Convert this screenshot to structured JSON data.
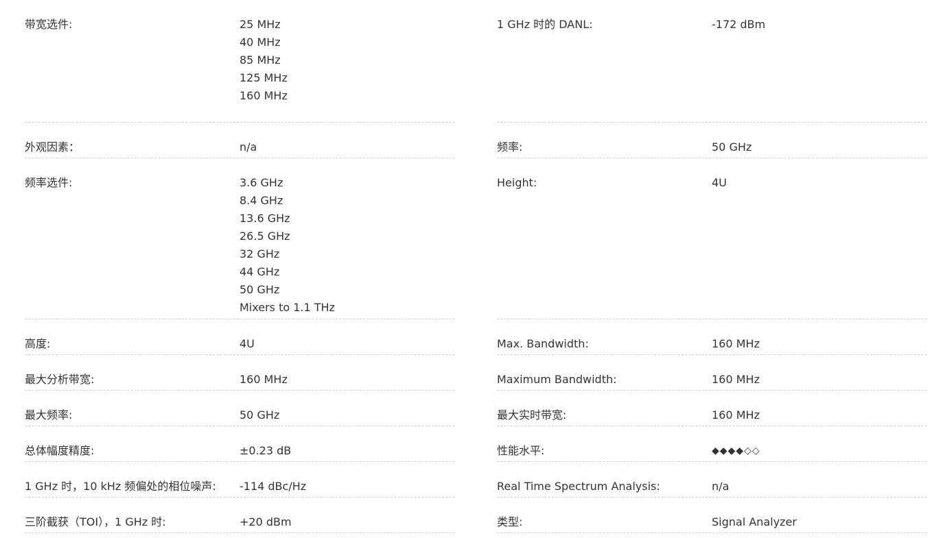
{
  "left": [
    {
      "label": "带宽选件:",
      "values": [
        "25 MHz",
        "40 MHz",
        "85 MHz",
        "125 MHz",
        "160 MHz"
      ]
    },
    {
      "label": "外观因素：",
      "values": [
        "n/a"
      ]
    },
    {
      "label": "频率选件:",
      "values": [
        "3.6 GHz",
        "8.4 GHz",
        "13.6 GHz",
        "26.5 GHz",
        "32 GHz",
        "44 GHz",
        "50 GHz",
        "Mixers to 1.1 THz"
      ]
    },
    {
      "label": "高度:",
      "values": [
        "4U"
      ]
    },
    {
      "label": "最大分析带宽:",
      "values": [
        "160 MHz"
      ]
    },
    {
      "label": "最大频率:",
      "values": [
        "50 GHz"
      ]
    },
    {
      "label": "总体幅度精度:",
      "values": [
        "±0.23 dB"
      ]
    },
    {
      "label": "1 GHz 时，10 kHz 频偏处的相位噪声:",
      "values": [
        "-114 dBc/Hz"
      ]
    },
    {
      "label": "三阶截获（TOI），1 GHz 时:",
      "values": [
        "+20 dBm"
      ]
    }
  ],
  "right": [
    {
      "label": "1 GHz 时的 DANL:",
      "values": [
        "-172 dBm"
      ]
    },
    {
      "label": "频率:",
      "values": [
        "50 GHz"
      ]
    },
    {
      "label": "Height:",
      "values": [
        "4U"
      ]
    },
    {
      "label": "Max. Bandwidth:",
      "values": [
        "160 MHz"
      ]
    },
    {
      "label": "Maximum Bandwidth:",
      "values": [
        "160 MHz"
      ]
    },
    {
      "label": "最大实时带宽:",
      "values": [
        "160 MHz"
      ]
    },
    {
      "label": "性能水平:",
      "values": [
        "◆◆◆◆◇◇"
      ]
    },
    {
      "label": "Real Time Spectrum Analysis:",
      "values": [
        "n/a"
      ]
    },
    {
      "label": "类型:",
      "values": [
        "Signal Analyzer"
      ]
    }
  ]
}
